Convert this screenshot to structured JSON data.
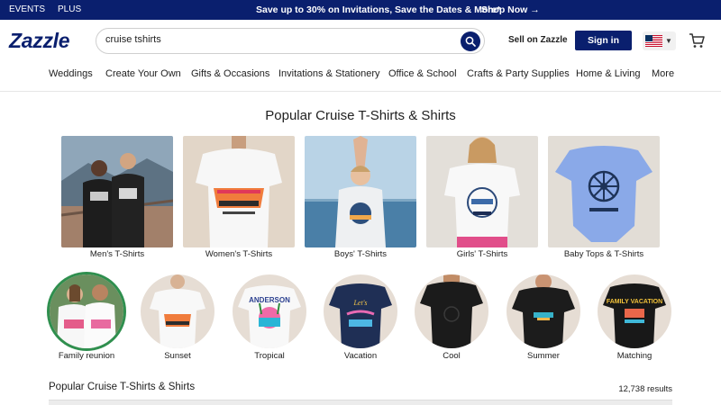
{
  "topbar": {
    "links": [
      "EVENTS",
      "PLUS"
    ],
    "promo": "Save up to 30% on Invitations, Save the Dates & More*",
    "shop_now": "Shop Now →"
  },
  "header": {
    "logo": "Zazzle",
    "search_value": "cruise tshirts",
    "sell": "Sell on Zazzle",
    "signin": "Sign in",
    "cart_icon": "cart-icon",
    "flag_icon": "us-flag-icon"
  },
  "nav": [
    "Weddings",
    "Create Your Own",
    "Gifts & Occasions",
    "Invitations & Stationery",
    "Office & School",
    "Crafts & Party Supplies",
    "Home & Living",
    "More"
  ],
  "section_title": "Popular Cruise T-Shirts & Shirts",
  "categories": [
    {
      "label": "Men's T-Shirts"
    },
    {
      "label": "Women's T-Shirts"
    },
    {
      "label": "Boys' T-Shirts"
    },
    {
      "label": "Girls' T-Shirts"
    },
    {
      "label": "Baby Tops & T-Shirts"
    }
  ],
  "styles": [
    {
      "label": "Family reunion"
    },
    {
      "label": "Sunset"
    },
    {
      "label": "Tropical"
    },
    {
      "label": "Vacation"
    },
    {
      "label": "Cool"
    },
    {
      "label": "Summer"
    },
    {
      "label": "Matching"
    }
  ],
  "product_text": {
    "tropical_name": "ANDERSON",
    "matching_text": "FAMILY VACATION"
  },
  "results_section": {
    "title": "Popular Cruise T-Shirts & Shirts",
    "count": "12,738 results"
  },
  "colors": {
    "brand_navy": "#0a1f6e",
    "nav_border": "#e6e6e6"
  }
}
